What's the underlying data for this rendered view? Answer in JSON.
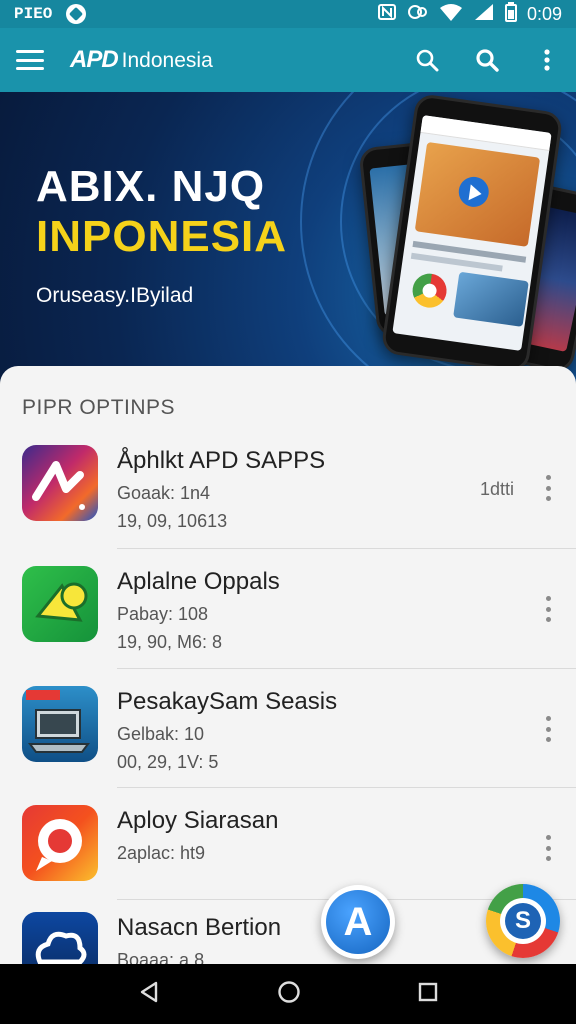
{
  "statusbar": {
    "left_text": "PIEO",
    "time": "0:09",
    "icons": [
      "nfc-icon",
      "sync-icon",
      "wifi-icon",
      "signal-icon",
      "battery-icon"
    ]
  },
  "appbar": {
    "logo": "APD",
    "title": "Indonesia",
    "actions": [
      "search-icon",
      "search-icon",
      "more-vert-icon"
    ]
  },
  "hero": {
    "title_line1": "ABIX. NJQ",
    "title_line2": "INPONESIA",
    "subtitle": "Oruseasy.IByilad",
    "accent_color": "#f5d21a"
  },
  "section": {
    "title": "PIPR OPTINPS"
  },
  "apps": [
    {
      "name": "Åphlkt APD SAPPS",
      "line1": "Goaak: 1n4",
      "line2": "19, 09, 10613",
      "side": "1dtti",
      "icon": "apd-logo-icon"
    },
    {
      "name": "Aplalne Oppals",
      "line1": "Pabay: 108",
      "line2": "19, 90, M6: 8",
      "side": "",
      "icon": "megaphone-icon"
    },
    {
      "name": "PesakaySam Seasis",
      "line1": "Gelbak: 10",
      "line2": "00, 29, 1V: 5",
      "side": "",
      "icon": "laptop-icon"
    },
    {
      "name": "Aploy Siarasan",
      "line1": "2aplac: ht9",
      "line2": "",
      "side": "",
      "icon": "chat-icon"
    },
    {
      "name": "Nasacn Bertion",
      "line1": "Boaaa: a 8",
      "line2": "",
      "side": "",
      "icon": "cloud-icon"
    }
  ],
  "fabs": {
    "primary": "A",
    "secondary": "S"
  },
  "navbar": [
    "back-icon",
    "home-icon",
    "recents-icon"
  ]
}
